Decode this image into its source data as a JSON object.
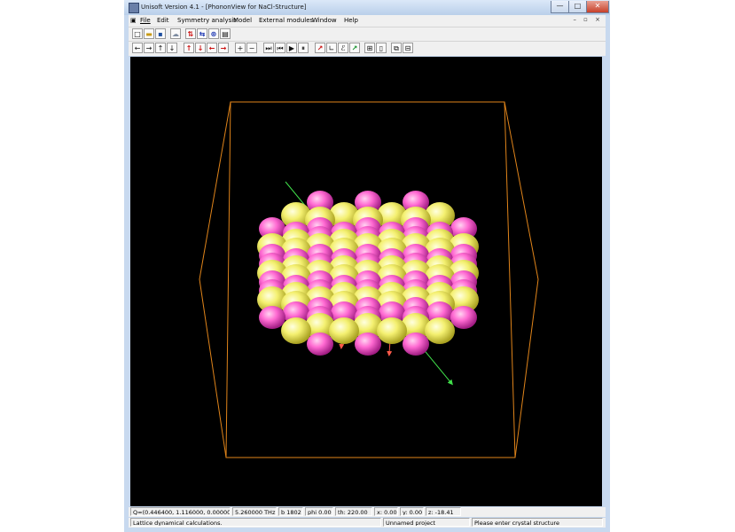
{
  "window": {
    "title": "Unisoft Version 4.1 - [PhononView for NaCl-Structure]",
    "controls": {
      "minimize": "—",
      "maximize": "□",
      "close": "✕"
    }
  },
  "menu": {
    "items": [
      "File",
      "Edit",
      "Symmetry analysis",
      "Model",
      "External modules",
      "Window",
      "Help"
    ],
    "mdi_controls": "– ▫ ×"
  },
  "toolbar1": {
    "icons": [
      "new-file-icon",
      "open-folder-icon",
      "save-icon",
      "cloud-icon",
      "red-arrows-icon",
      "rotate-icon",
      "atom-icon",
      "document-icon"
    ],
    "glyphs": [
      "□",
      "▬",
      "▪",
      "☁",
      "⇅",
      "⇆",
      "⊛",
      "▤"
    ]
  },
  "toolbar2": {
    "arrows": [
      "←",
      "→",
      "↑",
      "↓"
    ],
    "phonon_arrows": [
      "↑",
      "↓",
      "←",
      "→"
    ],
    "zoom": [
      "+",
      "−"
    ],
    "playback": [
      "⏭",
      "⏮",
      "▶",
      "⏸"
    ],
    "tools": [
      "↗",
      "∟",
      "ℰ",
      "↗"
    ],
    "extra": [
      "⊞",
      "▯",
      "⧉",
      "⊟"
    ]
  },
  "status": {
    "q": "Q=(0.446400, 1.116000, 0.000000)",
    "freq": "5.260000 THz",
    "b": "b 1802",
    "phi": "phi 0.00",
    "th": "th: 220.00",
    "x": "x: 0.00",
    "y": "y: 0.00",
    "z": "z: -18.41",
    "message": "Lattice dynamical calculations.",
    "project": "Unnamed project",
    "hint": "Please enter crystal structure"
  },
  "colors": {
    "viewport_bg": "#000000",
    "box_edge": "#e0841a",
    "na_atom": "#ff6ad2",
    "cl_atom": "#f4f070",
    "displacement_arrow": "#ff5a4a",
    "axis_green": "#40e04a"
  }
}
